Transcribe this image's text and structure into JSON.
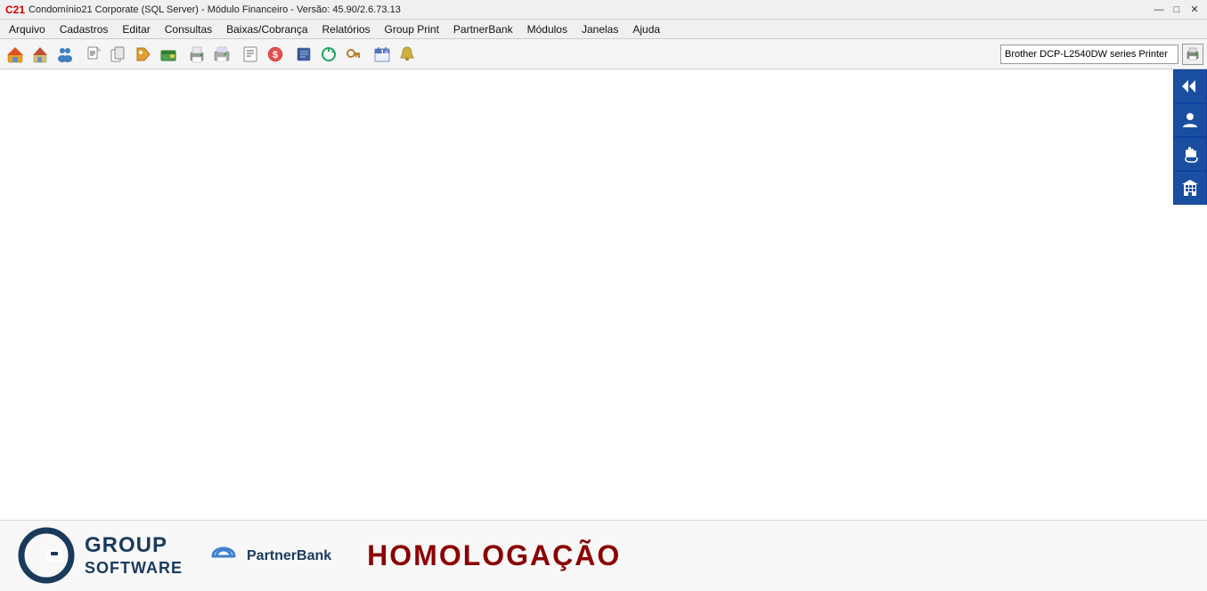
{
  "titlebar": {
    "title": "Condomínio21 Corporate  (SQL Server)  - Módulo Financeiro - Versão: 45.90/2.6.73.13",
    "controls": {
      "minimize": "—",
      "maximize": "□",
      "close": "✕"
    }
  },
  "menubar": {
    "items": [
      {
        "label": "Arquivo",
        "id": "arquivo"
      },
      {
        "label": "Cadastros",
        "id": "cadastros"
      },
      {
        "label": "Editar",
        "id": "editar"
      },
      {
        "label": "Consultas",
        "id": "consultas"
      },
      {
        "label": "Baixas/Cobrança",
        "id": "baixas-cobranca"
      },
      {
        "label": "Relatórios",
        "id": "relatorios"
      },
      {
        "label": "Group Print",
        "id": "group-print"
      },
      {
        "label": "PartnerBank",
        "id": "partnerbank"
      },
      {
        "label": "Módulos",
        "id": "modulos"
      },
      {
        "label": "Janelas",
        "id": "janelas"
      },
      {
        "label": "Ajuda",
        "id": "ajuda"
      }
    ]
  },
  "toolbar": {
    "printer_label": "Brother DCP-L2540DW series Printer",
    "printer_placeholder": "Brother DCP-L2540DW series Printer"
  },
  "right_panel": {
    "buttons": [
      {
        "id": "back-btn",
        "icon": "◀◀",
        "label": "back"
      },
      {
        "id": "person-btn",
        "icon": "👤",
        "label": "person"
      },
      {
        "id": "hand-btn",
        "icon": "👆",
        "label": "hand"
      },
      {
        "id": "building-btn",
        "icon": "🏢",
        "label": "building"
      }
    ]
  },
  "bottom": {
    "group_name": "GROUP",
    "group_sub": "SOFTWARE",
    "partnerbank": "PartnerBank",
    "homologacao": "HOMOLOGAÇÃO"
  }
}
